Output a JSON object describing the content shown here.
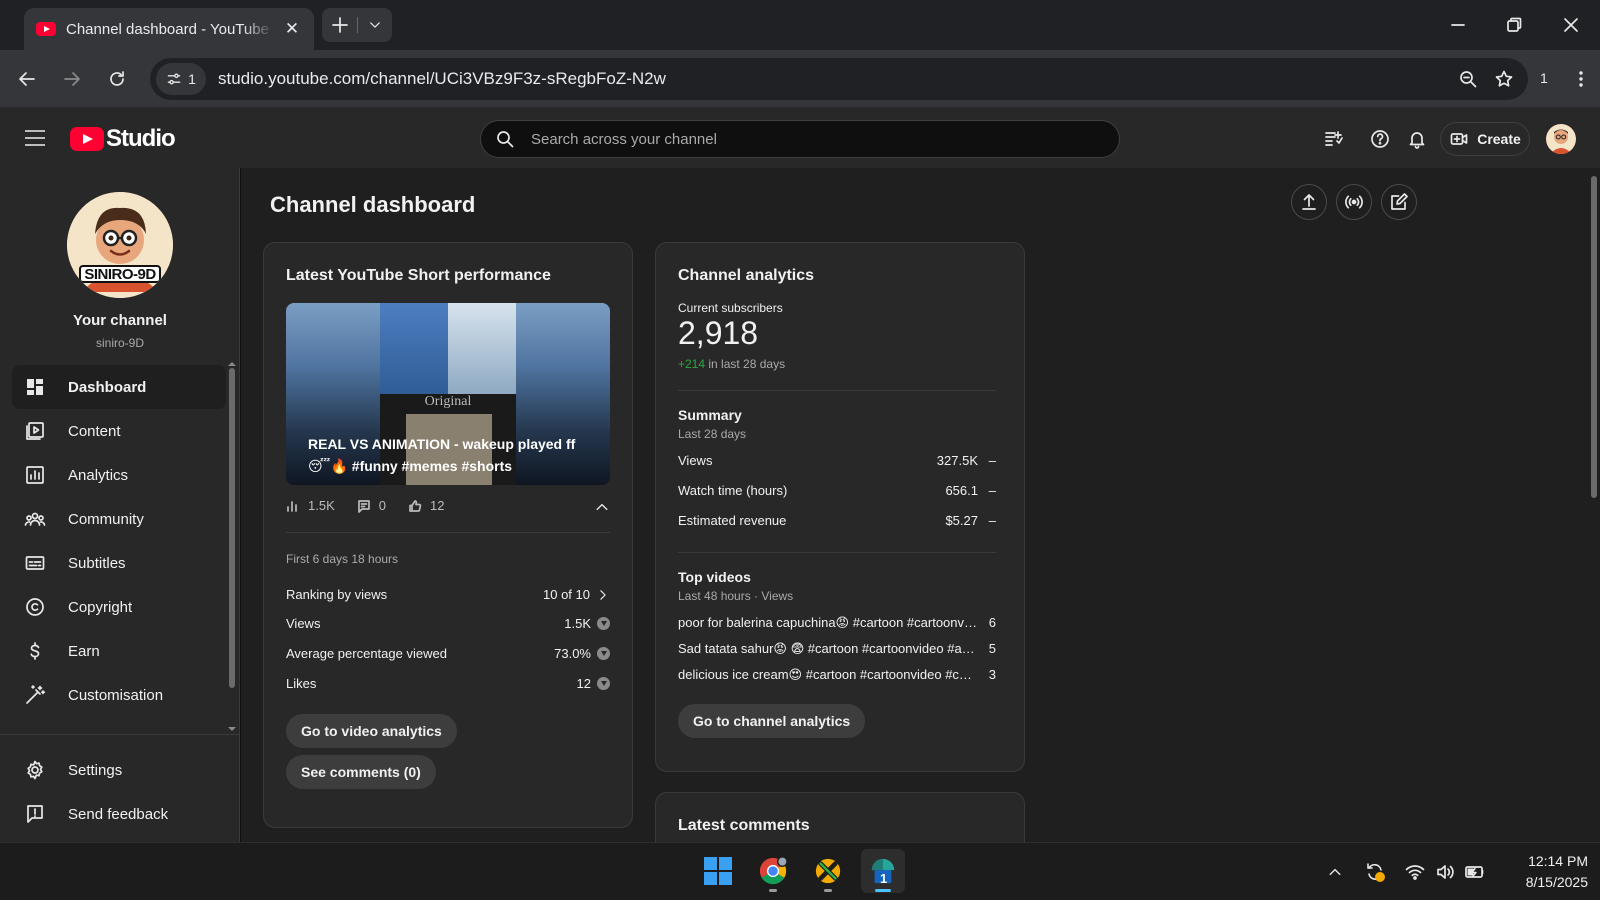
{
  "browser": {
    "tab_title": "Channel dashboard - YouTube Studio",
    "site_info_count": "1",
    "url": "studio.youtube.com/channel/UCi3VBz9F3z-sRegbFoZ-N2w",
    "extensions_count": "1"
  },
  "header": {
    "logo_text": "Studio",
    "search_placeholder": "Search across your channel",
    "create_label": "Create"
  },
  "sidebar": {
    "avatar_text": "SINIRO-9D",
    "channel_title": "Your channel",
    "channel_handle": "siniro-9D",
    "items": [
      {
        "label": "Dashboard",
        "icon": "dashboard-icon"
      },
      {
        "label": "Content",
        "icon": "content-icon"
      },
      {
        "label": "Analytics",
        "icon": "analytics-icon"
      },
      {
        "label": "Community",
        "icon": "community-icon"
      },
      {
        "label": "Subtitles",
        "icon": "subtitles-icon"
      },
      {
        "label": "Copyright",
        "icon": "copyright-icon"
      },
      {
        "label": "Earn",
        "icon": "earn-icon"
      },
      {
        "label": "Customisation",
        "icon": "customisation-icon"
      }
    ],
    "bottom_items": [
      {
        "label": "Settings",
        "icon": "gear-icon"
      },
      {
        "label": "Send feedback",
        "icon": "feedback-icon"
      }
    ]
  },
  "main": {
    "page_title": "Channel dashboard",
    "short_card": {
      "title": "Latest YouTube Short performance",
      "thumb_original": "Original",
      "caption": "REAL VS ANIMATION - wakeup played ff 😴🔥 #funny #memes #shorts",
      "views_short": "1.5K",
      "comments_short": "0",
      "likes_short": "12",
      "period": "First 6 days 18 hours",
      "ranking_label": "Ranking by views",
      "ranking_value": "10 of 10",
      "rows": [
        {
          "label": "Views",
          "value": "1.5K"
        },
        {
          "label": "Average percentage viewed",
          "value": "73.0%"
        },
        {
          "label": "Likes",
          "value": "12"
        }
      ],
      "analytics_button": "Go to video analytics",
      "comments_button": "See comments (0)"
    },
    "analytics_card": {
      "title": "Channel analytics",
      "subs_label": "Current subscribers",
      "subs_value": "2,918",
      "subs_delta": "+214",
      "subs_delta_suffix": "in last 28 days",
      "summary_title": "Summary",
      "summary_period": "Last 28 days",
      "summary_rows": [
        {
          "label": "Views",
          "value": "327.5K"
        },
        {
          "label": "Watch time (hours)",
          "value": "656.1"
        },
        {
          "label": "Estimated revenue",
          "value": "$5.27"
        }
      ],
      "top_title": "Top videos",
      "top_period": "Last 48 hours · Views",
      "top_rows": [
        {
          "title": "poor for balerina capuchina😡 #cartoon #cartoonvideo #anomaly",
          "value": "6"
        },
        {
          "title": "Sad tatata sahur😡 😨 #cartoon #cartoonvideo #anomaly",
          "value": "5"
        },
        {
          "title": "delicious ice cream😍 #cartoon #cartoonvideo #cartoon",
          "value": "3"
        }
      ],
      "button": "Go to channel analytics"
    },
    "comments_card": {
      "title": "Latest comments"
    }
  },
  "taskbar": {
    "notification_badge": "1",
    "time": "12:14 PM",
    "date": "8/15/2025"
  }
}
